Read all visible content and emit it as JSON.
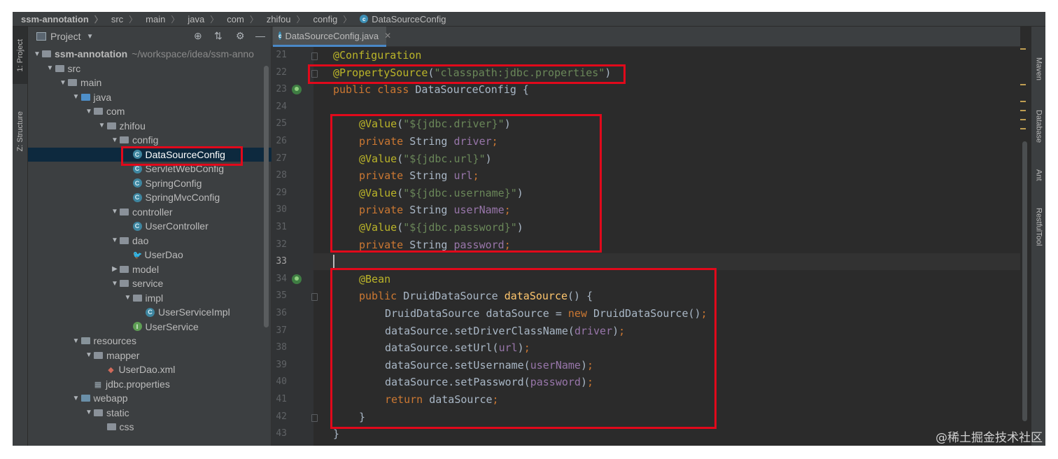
{
  "breadcrumb": {
    "items": [
      "ssm-annotation",
      "src",
      "main",
      "java",
      "com",
      "zhifou",
      "config",
      "DataSourceConfig"
    ]
  },
  "left_stripe": {
    "tabs": [
      "1: Project",
      "Z: Structure"
    ]
  },
  "right_stripe": {
    "tabs": [
      "Maven",
      "Database",
      "Ant",
      "RestfulTool"
    ]
  },
  "project_panel": {
    "title": "Project",
    "tree": [
      {
        "label": "ssm-annotation",
        "suffix": "~/workspace/idea/ssm-anno",
        "type": "module",
        "arrow": "down",
        "indent": 0
      },
      {
        "label": "src",
        "type": "folder",
        "arrow": "down",
        "indent": 1
      },
      {
        "label": "main",
        "type": "folder",
        "arrow": "down",
        "indent": 2
      },
      {
        "label": "java",
        "type": "folder-blue",
        "arrow": "down",
        "indent": 3
      },
      {
        "label": "com",
        "type": "folder",
        "arrow": "down",
        "indent": 4
      },
      {
        "label": "zhifou",
        "type": "folder",
        "arrow": "down",
        "indent": 5
      },
      {
        "label": "config",
        "type": "folder",
        "arrow": "down",
        "indent": 6
      },
      {
        "label": "DataSourceConfig",
        "type": "class",
        "arrow": "",
        "indent": 7,
        "selected": true
      },
      {
        "label": "ServletWebConfig",
        "type": "class",
        "arrow": "",
        "indent": 7
      },
      {
        "label": "SpringConfig",
        "type": "class",
        "arrow": "",
        "indent": 7
      },
      {
        "label": "SpringMvcConfig",
        "type": "class",
        "arrow": "",
        "indent": 7
      },
      {
        "label": "controller",
        "type": "folder",
        "arrow": "down",
        "indent": 6
      },
      {
        "label": "UserController",
        "type": "class",
        "arrow": "",
        "indent": 7
      },
      {
        "label": "dao",
        "type": "folder",
        "arrow": "down",
        "indent": 6
      },
      {
        "label": "UserDao",
        "type": "mapper",
        "arrow": "",
        "indent": 7
      },
      {
        "label": "model",
        "type": "folder",
        "arrow": "right",
        "indent": 6
      },
      {
        "label": "service",
        "type": "folder",
        "arrow": "down",
        "indent": 6
      },
      {
        "label": "impl",
        "type": "folder",
        "arrow": "down",
        "indent": 7
      },
      {
        "label": "UserServiceImpl",
        "type": "class",
        "arrow": "",
        "indent": 8
      },
      {
        "label": "UserService",
        "type": "interface",
        "arrow": "",
        "indent": 7
      },
      {
        "label": "resources",
        "type": "folder-res",
        "arrow": "down",
        "indent": 3
      },
      {
        "label": "mapper",
        "type": "folder",
        "arrow": "down",
        "indent": 4
      },
      {
        "label": "UserDao.xml",
        "type": "xml",
        "arrow": "",
        "indent": 5
      },
      {
        "label": "jdbc.properties",
        "type": "props",
        "arrow": "",
        "indent": 4
      },
      {
        "label": "webapp",
        "type": "folder-web",
        "arrow": "down",
        "indent": 3
      },
      {
        "label": "static",
        "type": "folder",
        "arrow": "down",
        "indent": 4
      },
      {
        "label": "css",
        "type": "folder",
        "arrow": "",
        "indent": 5
      }
    ]
  },
  "editor": {
    "tab_label": "DataSourceConfig.java",
    "current_line": 33,
    "lines": [
      {
        "n": "21",
        "indent": 0,
        "tokens": [
          [
            "ann",
            "@Configuration"
          ]
        ]
      },
      {
        "n": "22",
        "indent": 0,
        "tokens": [
          [
            "ann",
            "@PropertySource"
          ],
          [
            "p",
            "("
          ],
          [
            "str",
            "\"classpath:jdbc.properties\""
          ],
          [
            "p",
            ")"
          ]
        ]
      },
      {
        "n": "23",
        "indent": 0,
        "tokens": [
          [
            "kw",
            "public class "
          ],
          [
            "p",
            "DataSourceConfig {"
          ]
        ],
        "gutter_icon": true
      },
      {
        "n": "24",
        "indent": 0,
        "tokens": []
      },
      {
        "n": "25",
        "indent": 1,
        "tokens": [
          [
            "ann",
            "@Value"
          ],
          [
            "p",
            "("
          ],
          [
            "str",
            "\"${jdbc.driver}\""
          ],
          [
            "p",
            ")"
          ]
        ]
      },
      {
        "n": "26",
        "indent": 1,
        "tokens": [
          [
            "kw",
            "private "
          ],
          [
            "p",
            "String "
          ],
          [
            "fld",
            "driver"
          ],
          [
            "kw",
            ";"
          ]
        ]
      },
      {
        "n": "27",
        "indent": 1,
        "tokens": [
          [
            "ann",
            "@Value"
          ],
          [
            "p",
            "("
          ],
          [
            "str",
            "\"${jdbc.url}\""
          ],
          [
            "p",
            ")"
          ]
        ]
      },
      {
        "n": "28",
        "indent": 1,
        "tokens": [
          [
            "kw",
            "private "
          ],
          [
            "p",
            "String "
          ],
          [
            "fld",
            "url"
          ],
          [
            "kw",
            ";"
          ]
        ]
      },
      {
        "n": "29",
        "indent": 1,
        "tokens": [
          [
            "ann",
            "@Value"
          ],
          [
            "p",
            "("
          ],
          [
            "str",
            "\"${jdbc.username}\""
          ],
          [
            "p",
            ")"
          ]
        ]
      },
      {
        "n": "30",
        "indent": 1,
        "tokens": [
          [
            "kw",
            "private "
          ],
          [
            "p",
            "String "
          ],
          [
            "fld",
            "userName"
          ],
          [
            "kw",
            ";"
          ]
        ]
      },
      {
        "n": "31",
        "indent": 1,
        "tokens": [
          [
            "ann",
            "@Value"
          ],
          [
            "p",
            "("
          ],
          [
            "str",
            "\"${jdbc.password}\""
          ],
          [
            "p",
            ")"
          ]
        ]
      },
      {
        "n": "32",
        "indent": 1,
        "tokens": [
          [
            "kw",
            "private "
          ],
          [
            "p",
            "String "
          ],
          [
            "fld",
            "password"
          ],
          [
            "kw",
            ";"
          ]
        ]
      },
      {
        "n": "33",
        "indent": 0,
        "tokens": []
      },
      {
        "n": "34",
        "indent": 1,
        "tokens": [
          [
            "ann",
            "@Bean"
          ]
        ],
        "gutter_icon": true
      },
      {
        "n": "35",
        "indent": 1,
        "tokens": [
          [
            "kw",
            "public "
          ],
          [
            "p",
            "DruidDataSource "
          ],
          [
            "mth",
            "dataSource"
          ],
          [
            "p",
            "() {"
          ]
        ]
      },
      {
        "n": "36",
        "indent": 2,
        "tokens": [
          [
            "p",
            "DruidDataSource dataSource = "
          ],
          [
            "kw",
            "new "
          ],
          [
            "p",
            "DruidDataSource()"
          ],
          [
            "kw",
            ";"
          ]
        ]
      },
      {
        "n": "37",
        "indent": 2,
        "tokens": [
          [
            "p",
            "dataSource.setDriverClassName("
          ],
          [
            "fld",
            "driver"
          ],
          [
            "p",
            ")"
          ],
          [
            "kw",
            ";"
          ]
        ]
      },
      {
        "n": "38",
        "indent": 2,
        "tokens": [
          [
            "p",
            "dataSource.setUrl("
          ],
          [
            "fld",
            "url"
          ],
          [
            "p",
            ")"
          ],
          [
            "kw",
            ";"
          ]
        ]
      },
      {
        "n": "39",
        "indent": 2,
        "tokens": [
          [
            "p",
            "dataSource.setUsername("
          ],
          [
            "fld",
            "userName"
          ],
          [
            "p",
            ")"
          ],
          [
            "kw",
            ";"
          ]
        ]
      },
      {
        "n": "40",
        "indent": 2,
        "tokens": [
          [
            "p",
            "dataSource.setPassword("
          ],
          [
            "fld",
            "password"
          ],
          [
            "p",
            ")"
          ],
          [
            "kw",
            ";"
          ]
        ]
      },
      {
        "n": "41",
        "indent": 2,
        "tokens": [
          [
            "kw",
            "return "
          ],
          [
            "p",
            "dataSource"
          ],
          [
            "kw",
            ";"
          ]
        ]
      },
      {
        "n": "42",
        "indent": 1,
        "tokens": [
          [
            "p",
            "}"
          ]
        ]
      },
      {
        "n": "43",
        "indent": 0,
        "tokens": [
          [
            "p",
            "}"
          ]
        ]
      }
    ]
  },
  "watermark": "@稀土掘金技术社区",
  "colors": {
    "annotation": "#bbb529",
    "keyword": "#cc7832",
    "string": "#6a8759",
    "field": "#9876aa",
    "method": "#ffc66d",
    "plain": "#a9b7c6",
    "highlight_box": "#e1091b"
  }
}
